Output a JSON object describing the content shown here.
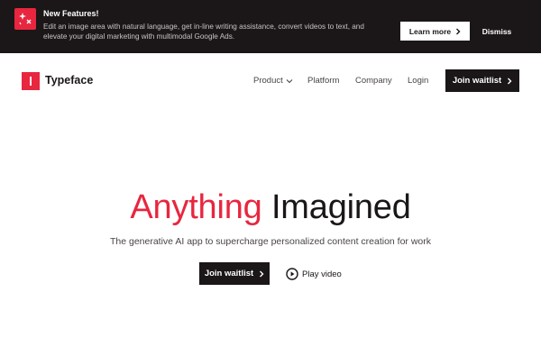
{
  "banner": {
    "title": "New Features!",
    "text": "Edit an image area with natural language, get in-line writing assistance, convert videos to text, and elevate your digital marketing with multimodal Google Ads.",
    "learn_more_label": "Learn more",
    "dismiss_label": "Dismiss",
    "icon": "sparkle-icon"
  },
  "nav": {
    "brand": "Typeface",
    "links": {
      "product": "Product",
      "platform": "Platform",
      "company": "Company",
      "login": "Login"
    },
    "cta_label": "Join waitlist"
  },
  "hero": {
    "title_accent": "Anything",
    "title_rest": " Imagined",
    "subtitle": "The generative AI app to supercharge personalized content creation for work",
    "cta_label": "Join waitlist",
    "play_label": "Play video"
  },
  "colors": {
    "brand_red": "#e8263f",
    "dark": "#1b1617"
  }
}
